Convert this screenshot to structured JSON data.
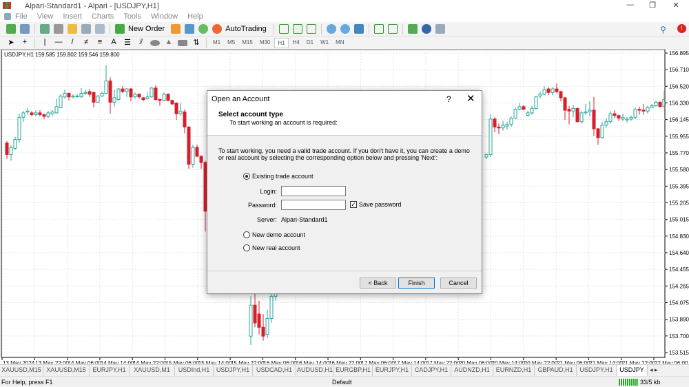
{
  "window": {
    "title": "Alpari-Standard1 - Alpari - [USDJPY,H1]",
    "minimize": "—",
    "maximize": "❐",
    "close": "✕"
  },
  "menu": [
    "File",
    "View",
    "Insert",
    "Charts",
    "Tools",
    "Window",
    "Help"
  ],
  "toolbar": {
    "new_order": "New Order",
    "autotrading": "AutoTrading",
    "timeframes": [
      "M1",
      "M5",
      "M15",
      "M30",
      "H1",
      "H4",
      "D1",
      "W1",
      "MN"
    ],
    "active_timeframe": "H1"
  },
  "chart": {
    "legend": "USDJPY,H1  159.585 159.802 159.546 159.800"
  },
  "chart_data": {
    "type": "candlestick",
    "symbol": "USDJPY",
    "timeframe": "H1",
    "bull_color": "#26a69a",
    "bear_color": "#d91e2a",
    "grid": true,
    "ylim": [
      153.515,
      156.895
    ],
    "y_ticks": [
      "156.895",
      "156.710",
      "156.520",
      "156.330",
      "156.145",
      "155.955",
      "155.770",
      "155.580",
      "155.395",
      "155.205",
      "155.015",
      "154.830",
      "154.640",
      "154.455",
      "154.265",
      "154.075",
      "153.890",
      "153.700",
      "153.515"
    ],
    "x_ticks": [
      "13 May 2024",
      "13 May 22:00",
      "14 May 06:00",
      "14 May 14:00",
      "14 May 22:00",
      "15 May 06:00",
      "15 May 14:00",
      "15 May 22:00",
      "16 May 06:00",
      "16 May 14:00",
      "16 May 22:00",
      "17 May 06:00",
      "17 May 14:00",
      "17 May 22:00",
      "20 May 06:00",
      "20 May 14:00",
      "20 May 22:00",
      "21 May 06:00",
      "21 May 14:00",
      "21 May 22:00",
      "22 May 06:00"
    ],
    "segments": [
      {
        "first_bar": 0,
        "ohlc": [
          [
            155.88,
            155.9,
            155.7,
            155.75
          ],
          [
            155.75,
            155.86,
            155.68,
            155.83
          ],
          [
            155.82,
            155.95,
            155.8,
            155.92
          ],
          [
            155.92,
            156.21,
            155.88,
            156.17
          ],
          [
            156.17,
            156.24,
            156.12,
            156.22
          ],
          [
            156.23,
            156.27,
            156.2,
            156.24
          ],
          [
            156.22,
            156.24,
            156.18,
            156.2
          ],
          [
            156.2,
            156.25,
            156.18,
            156.22
          ],
          [
            156.22,
            156.25,
            156.18,
            156.2
          ],
          [
            156.2,
            156.21,
            156.15,
            156.18
          ],
          [
            156.18,
            156.24,
            156.16,
            156.22
          ],
          [
            156.21,
            156.25,
            156.19,
            156.23
          ],
          [
            156.22,
            156.38,
            156.21,
            156.29
          ],
          [
            156.28,
            156.43,
            156.27,
            156.41
          ],
          [
            156.4,
            156.48,
            156.38,
            156.44
          ],
          [
            156.44,
            156.45,
            156.36,
            156.4
          ],
          [
            156.4,
            156.43,
            156.38,
            156.41
          ],
          [
            156.41,
            156.43,
            156.39,
            156.41
          ],
          [
            156.4,
            156.5,
            156.39,
            156.44
          ],
          [
            156.44,
            156.48,
            156.42,
            156.45
          ],
          [
            156.46,
            156.49,
            156.4,
            156.43
          ],
          [
            156.45,
            156.46,
            156.28,
            156.34
          ],
          [
            156.34,
            156.42,
            156.33,
            156.41
          ],
          [
            156.41,
            156.46,
            156.4,
            156.44
          ],
          [
            156.44,
            156.76,
            156.43,
            156.58
          ],
          [
            156.58,
            156.62,
            156.21,
            156.34
          ],
          [
            156.34,
            156.48,
            156.29,
            156.39
          ],
          [
            156.37,
            156.5,
            156.36,
            156.49
          ],
          [
            156.49,
            156.52,
            156.44,
            156.46
          ],
          [
            156.46,
            156.5,
            156.4,
            156.49
          ],
          [
            156.49,
            156.5,
            156.35,
            156.4
          ],
          [
            156.4,
            156.45,
            156.38,
            156.43
          ],
          [
            156.43,
            156.44,
            156.38,
            156.4
          ],
          [
            156.39,
            156.4,
            156.35,
            156.37
          ],
          [
            156.38,
            156.45,
            156.37,
            156.4
          ],
          [
            156.4,
            156.51,
            156.39,
            156.5
          ],
          [
            156.5,
            156.53,
            156.36,
            156.37
          ],
          [
            156.37,
            156.38,
            156.3,
            156.36
          ],
          [
            156.36,
            156.45,
            156.35,
            156.43
          ],
          [
            156.43,
            156.44,
            156.35,
            156.36
          ],
          [
            156.36,
            156.37,
            156.31,
            156.32
          ],
          [
            156.33,
            156.34,
            156.14,
            156.21
          ],
          [
            156.21,
            156.33,
            156.19,
            156.24
          ],
          [
            156.23,
            156.26,
            155.99,
            156.06
          ],
          [
            156.06,
            156.07,
            155.59,
            155.64
          ],
          [
            155.64,
            155.86,
            155.6,
            155.83
          ],
          [
            155.83,
            155.86,
            155.72,
            155.73
          ],
          [
            155.73,
            155.74,
            155.59,
            155.66
          ],
          [
            155.66,
            155.68,
            154.88,
            155.11
          ],
          [
            155.11,
            155.78,
            155.05,
            155.73
          ]
        ]
      },
      {
        "first_bar": 59,
        "ohlc": [
          [
            153.7,
            154.15,
            153.6,
            154.05
          ],
          [
            154.05,
            154.2,
            153.8,
            153.85
          ],
          [
            153.95,
            154.1,
            153.72,
            153.8
          ],
          [
            153.8,
            153.95,
            153.65,
            153.7
          ],
          [
            153.72,
            154.0,
            153.68,
            153.9
          ],
          [
            153.9,
            154.25,
            153.85,
            154.15
          ],
          [
            154.15,
            154.4,
            154.1,
            154.3
          ]
        ]
      },
      {
        "first_bar": 116,
        "ohlc": [
          [
            155.72,
            155.76,
            155.7,
            155.75
          ],
          [
            155.75,
            156.2,
            155.72,
            156.15
          ],
          [
            156.15,
            156.17,
            156.0,
            156.06
          ],
          [
            156.06,
            156.1,
            155.98,
            156.05
          ],
          [
            156.05,
            156.13,
            156.02,
            156.08
          ],
          [
            156.07,
            156.12,
            156.03,
            156.09
          ],
          [
            156.09,
            156.18,
            156.06,
            156.16
          ],
          [
            156.16,
            156.28,
            156.15,
            156.26
          ],
          [
            156.26,
            156.33,
            156.25,
            156.29
          ],
          [
            156.29,
            156.31,
            156.25,
            156.26
          ],
          [
            156.19,
            156.24,
            156.18,
            156.22
          ],
          [
            156.22,
            156.3,
            156.2,
            156.27
          ],
          [
            156.27,
            156.41,
            156.26,
            156.4
          ],
          [
            156.41,
            156.46,
            156.38,
            156.43
          ],
          [
            156.43,
            156.52,
            156.42,
            156.48
          ],
          [
            156.49,
            156.51,
            156.42,
            156.45
          ],
          [
            156.45,
            156.51,
            156.42,
            156.49
          ],
          [
            156.49,
            156.55,
            156.44,
            156.46
          ],
          [
            156.46,
            156.47,
            156.35,
            156.39
          ],
          [
            156.39,
            156.4,
            156.14,
            156.25
          ],
          [
            156.26,
            156.3,
            156.09,
            156.24
          ],
          [
            156.24,
            156.31,
            156.17,
            156.27
          ],
          [
            156.27,
            156.28,
            156.11,
            156.12
          ],
          [
            156.12,
            156.24,
            156.1,
            156.22
          ],
          [
            156.22,
            156.32,
            156.2,
            156.23
          ],
          [
            156.23,
            156.35,
            156.18,
            156.25
          ],
          [
            156.25,
            156.4,
            155.96,
            156.04
          ],
          [
            156.04,
            156.05,
            155.86,
            155.94
          ],
          [
            155.94,
            156.12,
            155.93,
            156.08
          ],
          [
            156.08,
            156.16,
            156.05,
            156.12
          ],
          [
            156.12,
            156.24,
            156.1,
            156.21
          ],
          [
            156.21,
            156.25,
            156.16,
            156.19
          ],
          [
            156.19,
            156.2,
            156.13,
            156.16
          ],
          [
            156.15,
            156.21,
            156.13,
            156.17
          ],
          [
            156.14,
            156.17,
            156.11,
            156.15
          ],
          [
            156.15,
            156.19,
            156.13,
            156.17
          ],
          [
            156.17,
            156.28,
            156.15,
            156.26
          ],
          [
            156.26,
            156.29,
            156.2,
            156.25
          ],
          [
            156.25,
            156.32,
            156.2,
            156.24
          ],
          [
            156.24,
            156.3,
            156.21,
            156.28
          ],
          [
            156.28,
            156.32,
            156.28,
            156.3
          ],
          [
            156.3,
            156.36,
            156.29,
            156.34
          ],
          [
            156.34,
            156.35,
            156.28,
            156.29
          ],
          [
            156.29,
            156.47,
            156.28,
            156.37
          ],
          [
            156.37,
            156.45,
            156.33,
            156.42
          ]
        ]
      }
    ]
  },
  "dialog": {
    "title": "Open an Account",
    "help": "?",
    "close": "✕",
    "heading": "Select account type",
    "subheading": "To start working an account is required:",
    "description": "To start working, you need a valid trade account. If you don't have it, you can create a demo or real account by selecting the corresponding option below and pressing 'Next':",
    "existing_label": "Existing trade account",
    "login_label": "Login:",
    "login_value": "",
    "password_label": "Password:",
    "password_value": "",
    "save_password_label": "Save password",
    "save_password_checked": true,
    "server_label": "Server:",
    "server_value": "Alpari-Standard1",
    "demo_label": "New demo account",
    "real_label": "New real account",
    "selected": "existing",
    "back": "< Back",
    "finish": "Finish",
    "cancel": "Cancel"
  },
  "tabs": [
    "XAUUSD,M15",
    "XAUUSD,M15",
    "EURJPY,H1",
    "XAUUSD,M1",
    "USDInd,H1",
    "USDJPY,H1",
    "USDCAD,H1",
    "AUDUSD,H1",
    "EURGBP,H1",
    "EURJPY,H1",
    "CADJPY,H1",
    "AUDNZD,H1",
    "EURNZD,H1",
    "GBPAUD,H1",
    "USDJPY,H1",
    "USDJPY"
  ],
  "active_tab": 15,
  "status": {
    "help": "For Help, press F1",
    "profile": "Default",
    "traffic": "33/5 kb"
  }
}
